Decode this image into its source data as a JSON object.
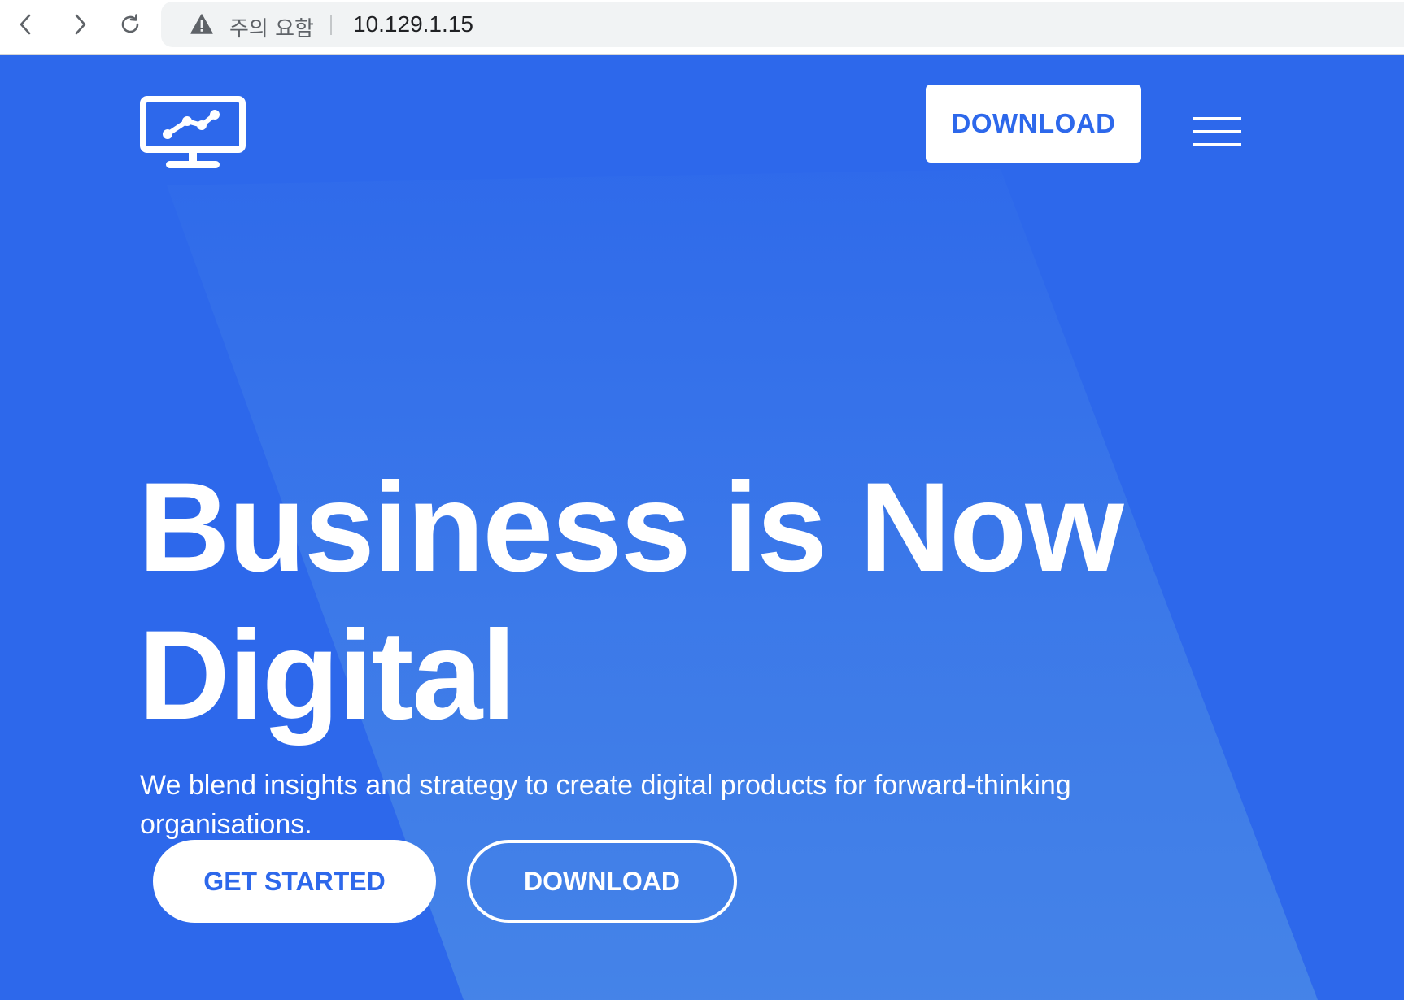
{
  "browser": {
    "back_icon": "chevron-left-icon",
    "forward_icon": "chevron-right-icon",
    "reload_icon": "reload-icon",
    "security_icon": "warning-triangle-icon",
    "security_label": "주의 요함",
    "url": "10.129.1.15"
  },
  "header": {
    "logo_icon": "monitor-chart-icon",
    "download_label": "DOWNLOAD",
    "menu_icon": "hamburger-menu-icon"
  },
  "hero": {
    "title": "Business is Now Digital",
    "subtitle": "We blend insights and strategy to create digital products for forward-thinking organisations.",
    "primary_button": "GET STARTED",
    "secondary_button": "DOWNLOAD"
  },
  "colors": {
    "background": "#2d68eb",
    "accent_text": "#2d68eb",
    "white": "#ffffff"
  }
}
